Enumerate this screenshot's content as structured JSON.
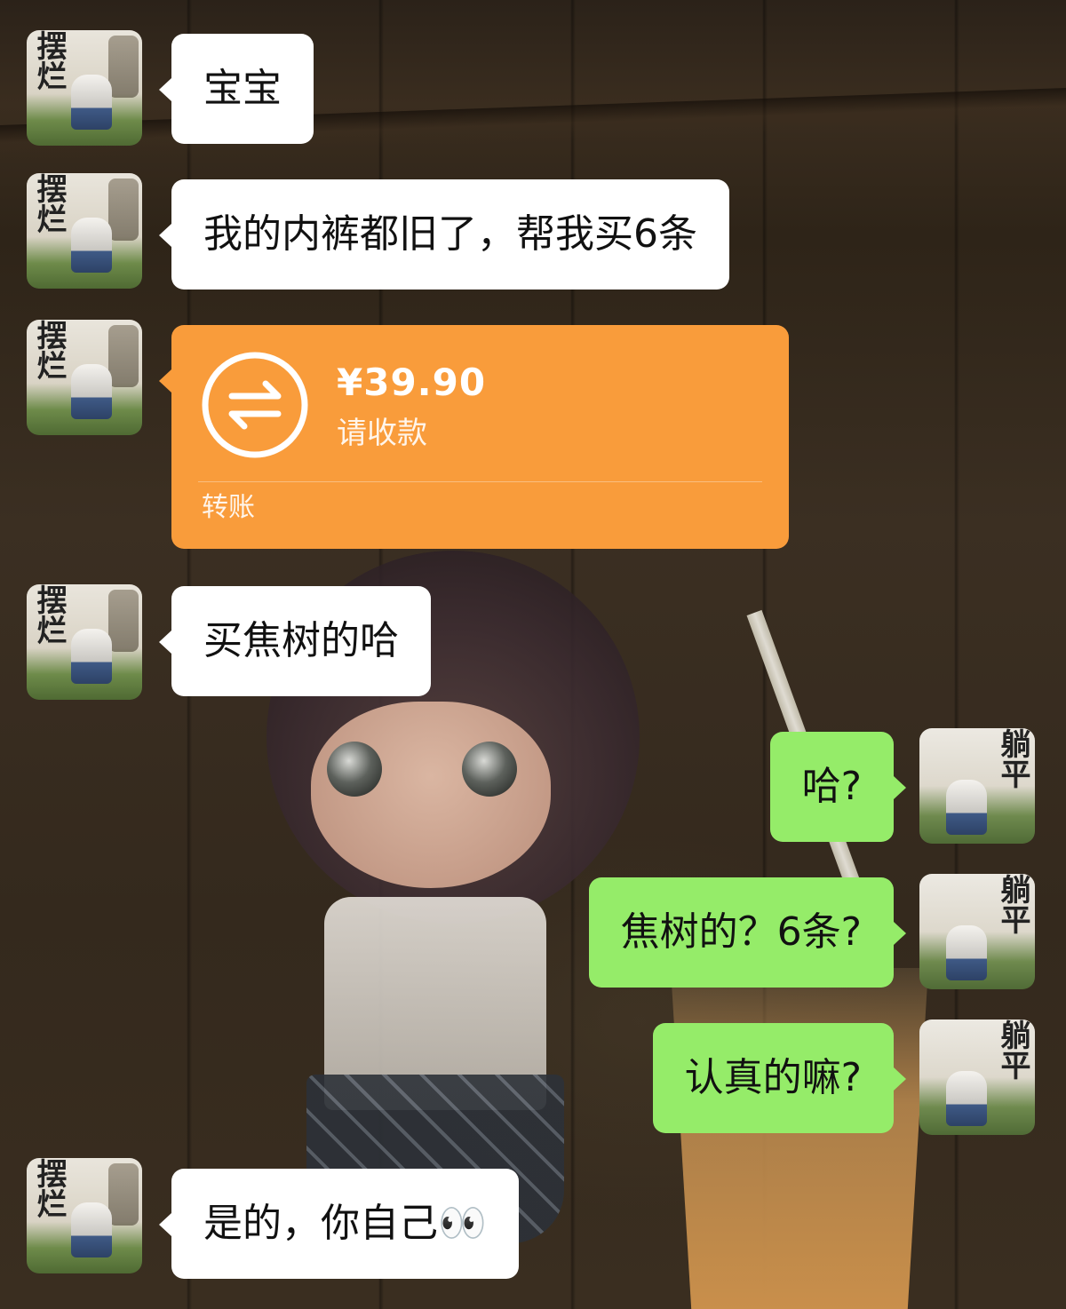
{
  "chat": {
    "messages": [
      {
        "side": "left",
        "type": "text",
        "text": "宝宝"
      },
      {
        "side": "left",
        "type": "text",
        "text": "我的内裤都旧了，帮我买6条"
      },
      {
        "side": "left",
        "type": "transfer",
        "amount": "¥39.90",
        "status": "请收款",
        "label": "转账"
      },
      {
        "side": "left",
        "type": "text",
        "text": "买焦树的哈"
      },
      {
        "side": "right",
        "type": "text",
        "text": "哈?"
      },
      {
        "side": "right",
        "type": "text",
        "text": "焦树的？6条?"
      },
      {
        "side": "right",
        "type": "text",
        "text": "认真的嘛?"
      },
      {
        "side": "left",
        "type": "text",
        "text": "是的，你自己👀"
      }
    ]
  },
  "avatars": {
    "friend_glyph": "摆烂",
    "me_glyph": "躺平"
  },
  "colors": {
    "incoming_bubble": "#ffffff",
    "outgoing_bubble": "#95ec69",
    "transfer_card": "#f99c3b",
    "background": "#34291d"
  },
  "icons": {
    "transfer": "transfer-arrows-icon"
  }
}
